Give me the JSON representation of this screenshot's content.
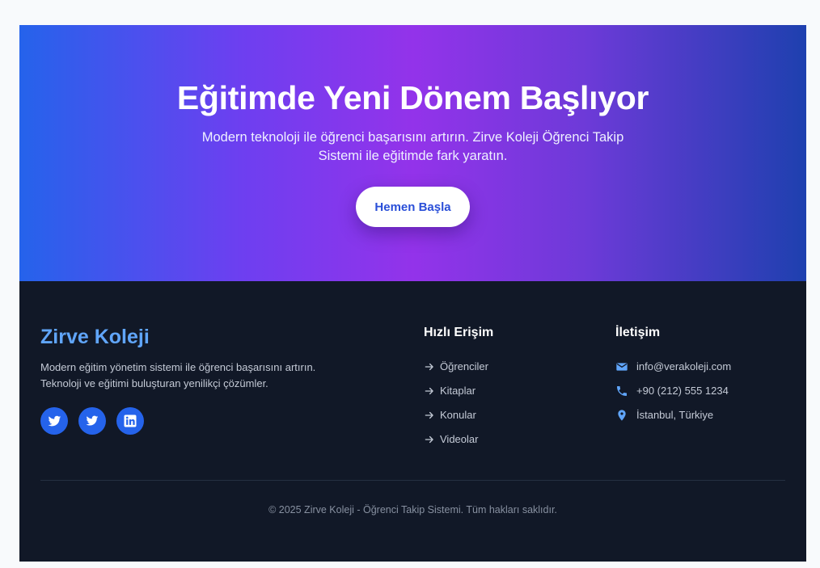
{
  "hero": {
    "title": "Eğitimde Yeni Dönem Başlıyor",
    "subtitle": "Modern teknoloji ile öğrenci başarısını artırın. Zirve Koleji Öğrenci Takip Sistemi ile eğitimde fark yaratın.",
    "cta_label": "Hemen Başla"
  },
  "footer": {
    "brand": "Zirve Koleji",
    "description": "Modern eğitim yönetim sistemi ile öğrenci başarısını artırın. Teknoloji ve eğitimi buluşturan yenilikçi çözümler.",
    "social": [
      {
        "icon": "twitter-icon"
      },
      {
        "icon": "twitter-icon"
      },
      {
        "icon": "linkedin-icon"
      }
    ],
    "quick_links": {
      "title": "Hızlı Erişim",
      "items": [
        "Öğrenciler",
        "Kitaplar",
        "Konular",
        "Videolar"
      ]
    },
    "contact": {
      "title": "İletişim",
      "email": "info@verakoleji.com",
      "phone": "+90 (212) 555 1234",
      "address": "İstanbul, Türkiye"
    },
    "copyright": "© 2025 Zirve Koleji - Öğrenci Takip Sistemi. Tüm hakları saklıdır."
  },
  "colors": {
    "accent": "#2563eb",
    "brand_text": "#60a5fa",
    "footer_bg": "#111827",
    "hero_gradient_mid": "#9333ea"
  }
}
